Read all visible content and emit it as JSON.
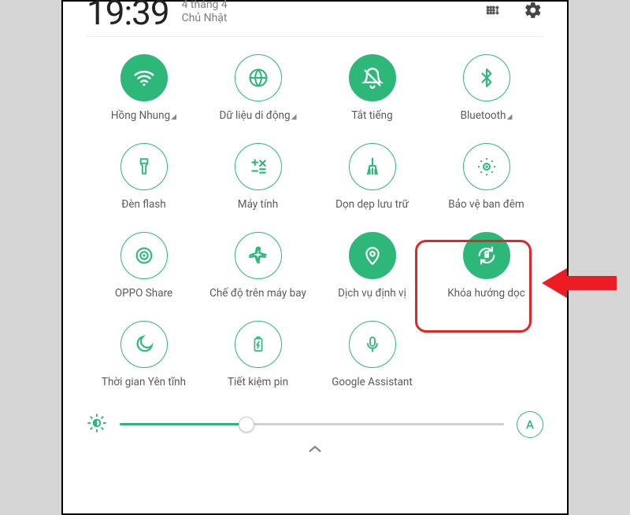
{
  "header": {
    "time": "19:39",
    "date_line1": "4 tháng 4",
    "date_line2": "Chủ Nhật"
  },
  "tiles": [
    {
      "id": "wifi",
      "label": "Hồng Nhung",
      "active": true,
      "expandable": true
    },
    {
      "id": "data",
      "label": "Dữ liệu di động",
      "active": false,
      "expandable": true
    },
    {
      "id": "mute",
      "label": "Tắt tiếng",
      "active": true,
      "expandable": false
    },
    {
      "id": "bluetooth",
      "label": "Bluetooth",
      "active": false,
      "expandable": true
    },
    {
      "id": "flashlight",
      "label": "Đèn flash",
      "active": false,
      "expandable": false
    },
    {
      "id": "calculator",
      "label": "Máy tính",
      "active": false,
      "expandable": false
    },
    {
      "id": "cleanup",
      "label": "Dọn dẹp lưu trữ",
      "active": false,
      "expandable": false
    },
    {
      "id": "night",
      "label": "Bảo vệ ban đêm",
      "active": false,
      "expandable": false
    },
    {
      "id": "opposhare",
      "label": "OPPO Share",
      "active": false,
      "expandable": false
    },
    {
      "id": "airplane",
      "label": "Chế độ trên máy bay",
      "active": false,
      "expandable": false
    },
    {
      "id": "location",
      "label": "Dịch vụ định vị",
      "active": true,
      "expandable": false
    },
    {
      "id": "rotation",
      "label": "Khóa hướng dọc",
      "active": true,
      "expandable": false
    },
    {
      "id": "quiet",
      "label": "Thời gian Yên tĩnh",
      "active": false,
      "expandable": false
    },
    {
      "id": "battery",
      "label": "Tiết kiệm pin",
      "active": false,
      "expandable": false
    },
    {
      "id": "assistant",
      "label": "Google Assistant",
      "active": false,
      "expandable": false
    }
  ],
  "brightness": {
    "auto_label": "A",
    "value_percent": 33
  },
  "accent_color": "#2db87a",
  "highlight_tile": "rotation"
}
